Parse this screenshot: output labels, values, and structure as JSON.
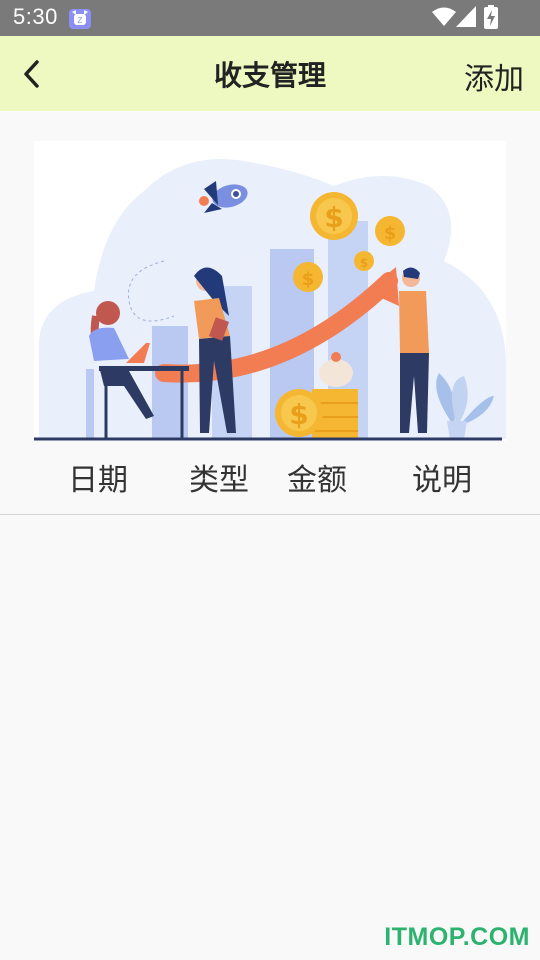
{
  "status_bar": {
    "time": "5:30",
    "icons": [
      "notification-cat-icon",
      "wifi-icon",
      "signal-icon",
      "battery-charging-icon"
    ]
  },
  "app_bar": {
    "back_icon": "chevron-left-icon",
    "title": "收支管理",
    "add_label": "添加",
    "background": "#edf9c0"
  },
  "illustration": {
    "subject": "finance-growth-illustration"
  },
  "table": {
    "columns": [
      "日期",
      "类型",
      "金额",
      "说明"
    ],
    "rows": []
  },
  "watermark": "ITMOP.COM",
  "colors": {
    "accent_orange": "#f27d52",
    "coin_yellow": "#f5b731",
    "bar_blue": "#b9c9f2",
    "watermark_green": "#2db36f"
  }
}
